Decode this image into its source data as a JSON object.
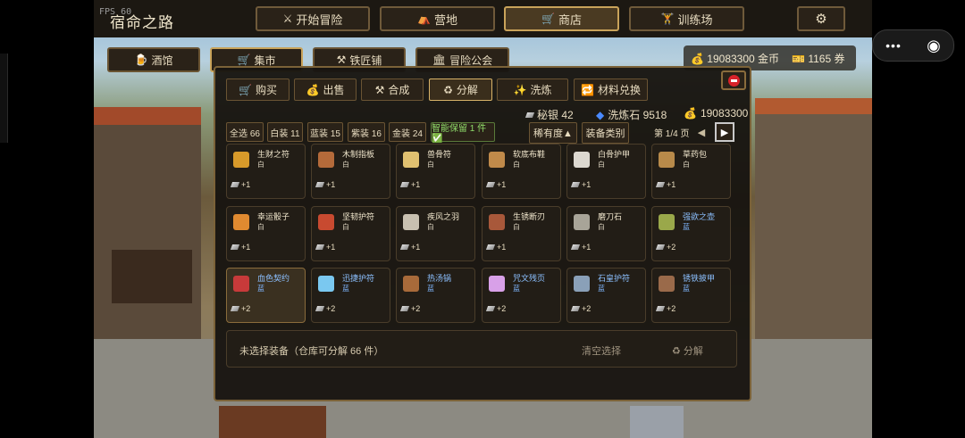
{
  "fps": "FPS 60",
  "title": "宿命之路",
  "nav": [
    {
      "label": "开始冒险",
      "icon": "⚔"
    },
    {
      "label": "营地",
      "icon": "⛺"
    },
    {
      "label": "商店",
      "icon": "🛒"
    },
    {
      "label": "训练场",
      "icon": "🏋"
    }
  ],
  "settings_icon": "⚙",
  "subnav": [
    {
      "label": "酒馆",
      "icon": "🍺"
    },
    {
      "label": "集市",
      "icon": "🛒"
    },
    {
      "label": "铁匠铺",
      "icon": "⚒"
    },
    {
      "label": "冒险公会",
      "icon": "🏛"
    }
  ],
  "currency": {
    "gold": "19083300 金币",
    "ticket": "1165 券"
  },
  "tabs": [
    {
      "label": "购买",
      "icon": "🛒"
    },
    {
      "label": "出售",
      "icon": "💰"
    },
    {
      "label": "合成",
      "icon": "⚒"
    },
    {
      "label": "分解",
      "icon": "♻"
    },
    {
      "label": "洗炼",
      "icon": "✨"
    },
    {
      "label": "材料兑换",
      "icon": "🔁"
    }
  ],
  "resources": {
    "silver": "秘银 42",
    "stone": "洗炼石 9518",
    "gold": "19083300"
  },
  "filters": [
    "全选 66",
    "白装 11",
    "蓝装 15",
    "紫装 16",
    "金装 24",
    "智能保留 1 件 ✅"
  ],
  "sort": {
    "rarity": "稀有度▲",
    "category": "装备类别"
  },
  "pagination": {
    "text": "第 1/4 页",
    "prev": "◀",
    "next": "▶"
  },
  "items": [
    {
      "name": "生财之符",
      "rarity": "白",
      "value": "+1",
      "color": "#d89a2a"
    },
    {
      "name": "木制指板",
      "rarity": "白",
      "value": "+1",
      "color": "#b46a3a"
    },
    {
      "name": "兽骨符",
      "rarity": "白",
      "value": "+1",
      "color": "#e0c070"
    },
    {
      "name": "软底布鞋",
      "rarity": "白",
      "value": "+1",
      "color": "#c08a4a"
    },
    {
      "name": "白骨护甲",
      "rarity": "白",
      "value": "+1",
      "color": "#dcd8d0"
    },
    {
      "name": "草药包",
      "rarity": "白",
      "value": "+1",
      "color": "#b88a4a"
    },
    {
      "name": "幸运骰子",
      "rarity": "白",
      "value": "+1",
      "color": "#e08a30"
    },
    {
      "name": "坚韧护符",
      "rarity": "白",
      "value": "+1",
      "color": "#c84a30"
    },
    {
      "name": "疾风之羽",
      "rarity": "白",
      "value": "+1",
      "color": "#c8c0b0"
    },
    {
      "name": "生锈断刃",
      "rarity": "白",
      "value": "+1",
      "color": "#a8583a"
    },
    {
      "name": "磨刀石",
      "rarity": "白",
      "value": "+1",
      "color": "#a8a498"
    },
    {
      "name": "强欲之壶",
      "rarity": "蓝",
      "value": "+2",
      "color": "#9aa84a"
    },
    {
      "name": "血色契约",
      "rarity": "蓝",
      "value": "+2",
      "color": "#c83a3a"
    },
    {
      "name": "迅捷护符",
      "rarity": "蓝",
      "value": "+2",
      "color": "#7ac8f0"
    },
    {
      "name": "热汤锅",
      "rarity": "蓝",
      "value": "+2",
      "color": "#a86a3a"
    },
    {
      "name": "咒文残页",
      "rarity": "蓝",
      "value": "+2",
      "color": "#d8a0e8"
    },
    {
      "name": "石皇护符",
      "rarity": "蓝",
      "value": "+2",
      "color": "#8aa0b8"
    },
    {
      "name": "锈铁披甲",
      "rarity": "蓝",
      "value": "+2",
      "color": "#9a6a4a"
    }
  ],
  "footer": {
    "status": "未选择装备（仓库可分解 66 件）",
    "clear": "清空选择",
    "decompose": "♻ 分解"
  },
  "capsule": {
    "menu": "•••",
    "close": "◉"
  }
}
